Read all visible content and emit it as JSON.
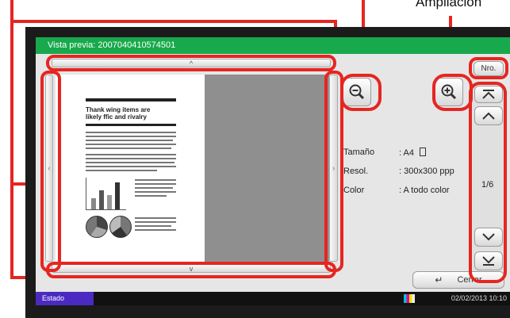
{
  "callouts": {
    "ampliacion": "Ampliación"
  },
  "window": {
    "title": "Vista previa: 2007040410574501"
  },
  "buttons": {
    "nro": "Nro.",
    "cerrar": "Cerrar"
  },
  "scroll": {
    "up_arrow": "^",
    "down_arrow": "v",
    "left_arrow": "‹",
    "right_arrow": "›"
  },
  "info": {
    "size_label": "Tamaño",
    "size_value": ": A4",
    "resol_label": "Resol.",
    "resol_value": ": 300x300 ppp",
    "color_label": "Color",
    "color_value": ": A todo color"
  },
  "paging": {
    "page_indicator": "1/6"
  },
  "statusbar": {
    "estado": "Estado",
    "datetime": "02/02/2013  10:10"
  },
  "preview_doc": {
    "heading_line1": "Thank  wing items are",
    "heading_line2": "likely  ffic and rivalry"
  },
  "colors": {
    "callout": "#e52621",
    "titlebar": "#18a94d",
    "estado": "#4a2ac0"
  }
}
